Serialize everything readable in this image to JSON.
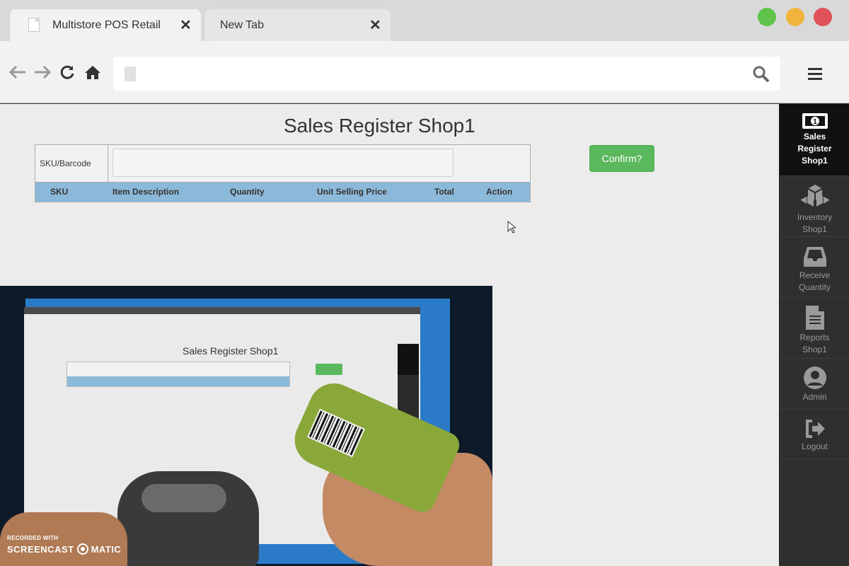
{
  "browser": {
    "tabs": [
      {
        "title": "Multistore POS Retail",
        "close": "✕"
      },
      {
        "title": "New Tab",
        "close": "✕"
      }
    ],
    "window_controls": {
      "green": "#5ec24b",
      "yellow": "#f0b33c",
      "red": "#e0525a"
    }
  },
  "page": {
    "title": "Sales Register Shop1",
    "sku_label": "SKU/Barcode",
    "sku_value": "",
    "columns": [
      "SKU",
      "Item Description",
      "Quantity",
      "Unit Selling Price",
      "Total",
      "Action"
    ],
    "confirm_label": "Confirm?",
    "accent_green": "#5cb85c",
    "header_blue": "#8cb9d9"
  },
  "sidebar": {
    "items": [
      {
        "label_lines": [
          "Sales",
          "Register",
          "Shop1"
        ],
        "icon": "money-icon",
        "active": true
      },
      {
        "label_lines": [
          "Inventory",
          "Shop1"
        ],
        "icon": "cubes-icon",
        "active": false
      },
      {
        "label_lines": [
          "Receive",
          "Quantity"
        ],
        "icon": "inbox-icon",
        "active": false
      },
      {
        "label_lines": [
          "Reports",
          "Shop1"
        ],
        "icon": "document-icon",
        "active": false
      },
      {
        "label_lines": [
          "Admin"
        ],
        "icon": "user-icon",
        "active": false
      },
      {
        "label_lines": [
          "Logout"
        ],
        "icon": "sign-out-icon",
        "active": false
      }
    ]
  },
  "webcam": {
    "inner_title": "Sales Register Shop1",
    "watermark_line1": "RECORDED WITH",
    "watermark_brand_a": "SCREENCAST",
    "watermark_brand_b": "MATIC"
  }
}
